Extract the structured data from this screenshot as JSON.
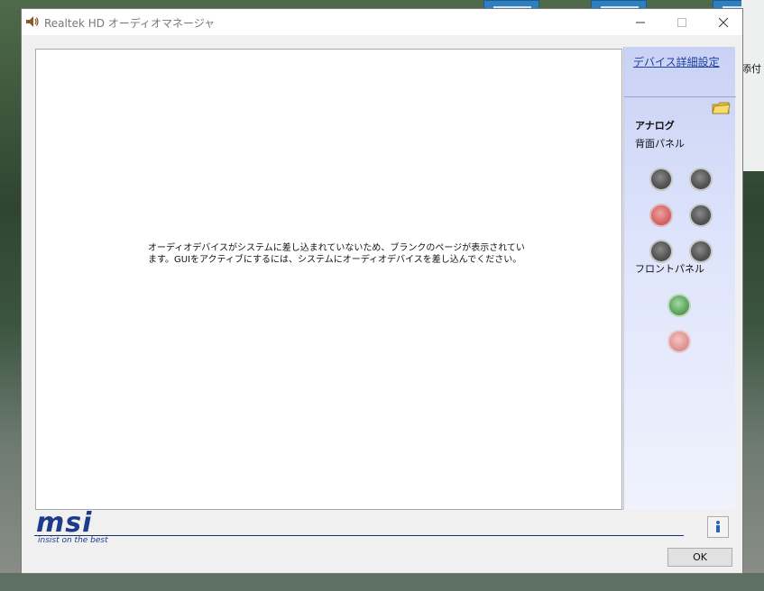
{
  "window": {
    "title": "Realtek HD オーディオマネージャ",
    "min_icon": "minimize-icon",
    "max_icon": "maximize-icon",
    "close_icon": "close-icon"
  },
  "main": {
    "message": "オーディオデバイスがシステムに差し込まれていないため、ブランクのページが表示されています。GUIをアクティブにするには、システムにオーディオデバイスを差し込んでください。"
  },
  "sidebar": {
    "device_settings_link": "デバイス詳細設定",
    "analog_label": "アナログ",
    "back_panel_label": "背面パネル",
    "front_panel_label": "フロントパネル",
    "back_jacks": [
      "gray",
      "gray",
      "red",
      "gray",
      "gray",
      "gray"
    ],
    "front_jacks": [
      "green",
      "pink"
    ]
  },
  "footer": {
    "logo": "msi",
    "tagline": "insist on the best",
    "ok_label": "OK"
  },
  "background": {
    "right_text": "添付"
  },
  "colors": {
    "link": "#1d3f9e",
    "brand": "#1d3a8c"
  }
}
